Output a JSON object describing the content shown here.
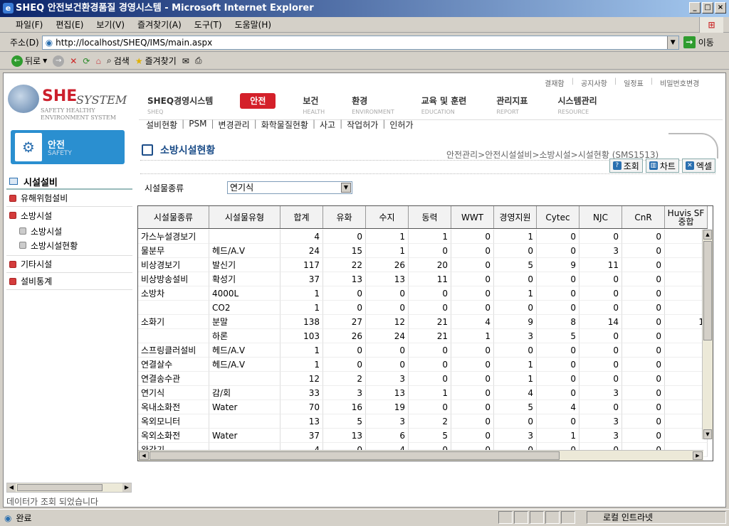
{
  "window": {
    "title": "SHEQ 안전보건환경품질 경영시스템 - Microsoft Internet Explorer"
  },
  "menu": [
    "파일(F)",
    "편집(E)",
    "보기(V)",
    "즐겨찾기(A)",
    "도구(T)",
    "도움말(H)"
  ],
  "address": {
    "label": "주소(D)",
    "url": "http://localhost/SHEQ/IMS/main.aspx",
    "go": "이동"
  },
  "toolbar": {
    "back": "뒤로",
    "search": "검색",
    "favorites": "즐겨찾기"
  },
  "logo": {
    "she": "SHE",
    "system": "SYSTEM",
    "sub1": "SAFETY HEALTHY",
    "sub2": "ENVIRONMENT SYSTEM"
  },
  "section": {
    "title": "안전",
    "sub": "SAFETY"
  },
  "sidebar": {
    "header": "시설설비",
    "items": [
      {
        "label": "유해위험설비"
      },
      {
        "label": "소방시설",
        "children": [
          "소방시설",
          "소방시설현황"
        ]
      },
      {
        "label": "기타시설"
      },
      {
        "label": "설비통계"
      }
    ]
  },
  "util": [
    "결재함",
    "공지사항",
    "일정표",
    "비밀번호변경"
  ],
  "mainnav": [
    {
      "k": "SHEQ경영시스템",
      "e": "SHEQ"
    },
    {
      "k": "안전",
      "e": ""
    },
    {
      "k": "보건",
      "e": "HEALTH"
    },
    {
      "k": "환경",
      "e": "ENVIRONMENT"
    },
    {
      "k": "교육 및 훈련",
      "e": "EDUCATION"
    },
    {
      "k": "관리지표",
      "e": "REPORT"
    },
    {
      "k": "시스템관리",
      "e": "RESOURCE"
    }
  ],
  "subnav": [
    "설비현황",
    "PSM",
    "변경관리",
    "화학물질현황",
    "사고",
    "작업허가",
    "인허가"
  ],
  "page": {
    "title": "소방시설현황",
    "breadcrumb": "안전관리>안전시설설비>소방시설>시설현황 (SMS1513)"
  },
  "actions": {
    "search": "조회",
    "chart": "차트",
    "excel": "엑셀"
  },
  "filter": {
    "label": "시설물종류",
    "value": "연기식"
  },
  "table": {
    "headers": [
      "시설물종류",
      "시설물유형",
      "합계",
      "유화",
      "수지",
      "동력",
      "WWT",
      "경영지원",
      "Cytec",
      "NJC",
      "CnR",
      "Huvis SF\n중합"
    ],
    "rows": [
      [
        "가스누설경보기",
        "",
        "4",
        "0",
        "1",
        "1",
        "0",
        "1",
        "0",
        "0",
        "0",
        ""
      ],
      [
        "물분무",
        "헤드/A.V",
        "24",
        "15",
        "1",
        "0",
        "0",
        "0",
        "0",
        "3",
        "0",
        ""
      ],
      [
        "비상경보기",
        "발신기",
        "117",
        "22",
        "26",
        "20",
        "0",
        "5",
        "9",
        "11",
        "0",
        ""
      ],
      [
        "비상방송설비",
        "확성기",
        "37",
        "13",
        "13",
        "11",
        "0",
        "0",
        "0",
        "0",
        "0",
        ""
      ],
      [
        "소방차",
        "4000L",
        "1",
        "0",
        "0",
        "0",
        "0",
        "1",
        "0",
        "0",
        "0",
        ""
      ],
      [
        "",
        "CO2",
        "1",
        "0",
        "0",
        "0",
        "0",
        "0",
        "0",
        "0",
        "0",
        ""
      ],
      [
        "소화기",
        "분말",
        "138",
        "27",
        "12",
        "21",
        "4",
        "9",
        "8",
        "14",
        "0",
        "1"
      ],
      [
        "",
        "하론",
        "103",
        "26",
        "24",
        "21",
        "1",
        "3",
        "5",
        "0",
        "0",
        ""
      ],
      [
        "스프링클러설비",
        "헤드/A.V",
        "1",
        "0",
        "0",
        "0",
        "0",
        "0",
        "0",
        "0",
        "0",
        ""
      ],
      [
        "연결살수",
        "헤드/A.V",
        "1",
        "0",
        "0",
        "0",
        "0",
        "1",
        "0",
        "0",
        "0",
        ""
      ],
      [
        "연결송수관",
        "",
        "12",
        "2",
        "3",
        "0",
        "0",
        "1",
        "0",
        "0",
        "0",
        ""
      ],
      [
        "연기식",
        "감/회",
        "33",
        "3",
        "13",
        "1",
        "0",
        "4",
        "0",
        "3",
        "0",
        ""
      ],
      [
        "옥내소화전",
        "Water",
        "70",
        "16",
        "19",
        "0",
        "0",
        "5",
        "4",
        "0",
        "0",
        ""
      ],
      [
        "옥외모니터",
        "",
        "13",
        "5",
        "3",
        "2",
        "0",
        "0",
        "0",
        "3",
        "0",
        ""
      ],
      [
        "옥외소화전",
        "Water",
        "37",
        "13",
        "6",
        "5",
        "0",
        "3",
        "1",
        "3",
        "0",
        ""
      ],
      [
        "완강기",
        "",
        "4",
        "0",
        "4",
        "0",
        "0",
        "0",
        "0",
        "0",
        "0",
        ""
      ]
    ]
  },
  "statusmsg": "데이터가 조회 되었습니다",
  "statusbar": {
    "done": "완료",
    "zone": "로컬 인트라넷"
  }
}
